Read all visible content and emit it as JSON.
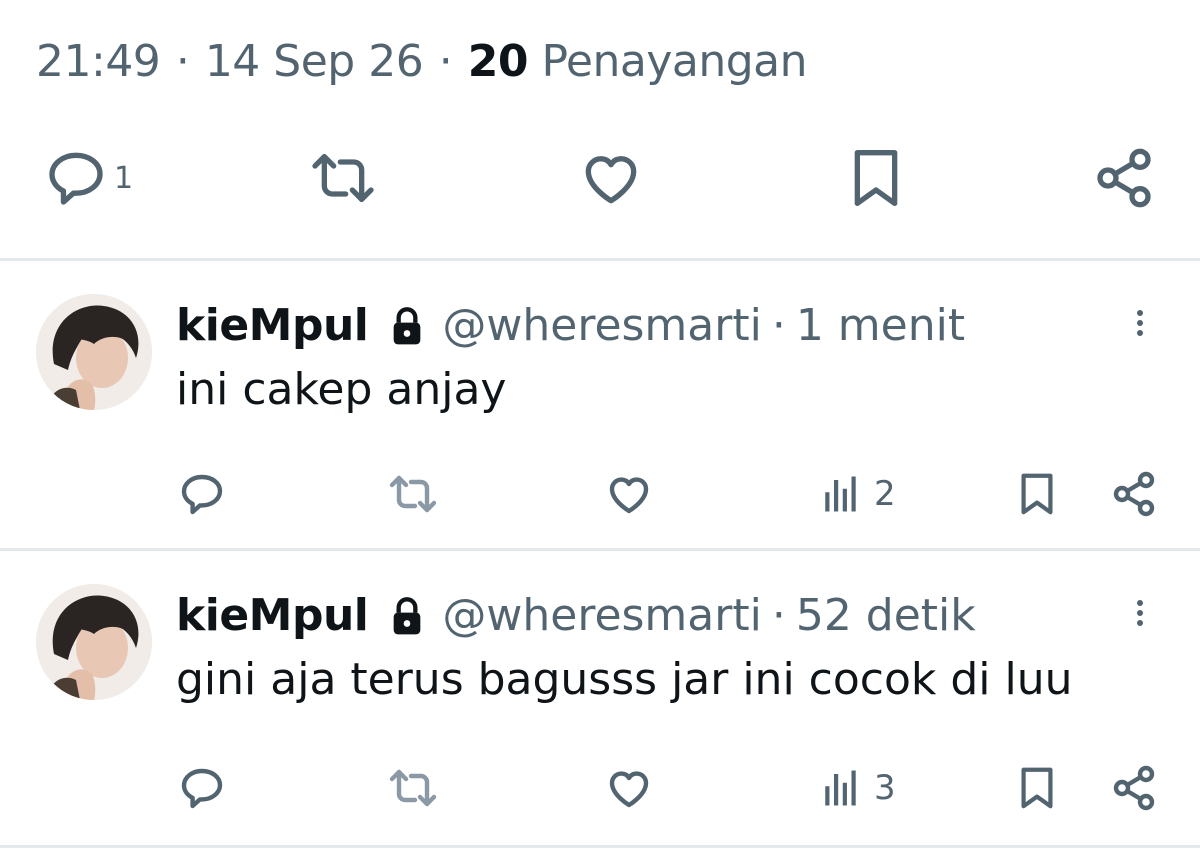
{
  "post_meta": {
    "time": "21:49",
    "separator": "·",
    "date": "14 Sep 26",
    "views_count": "20",
    "views_label": "Penayangan"
  },
  "main_actions": {
    "reply_count": "1"
  },
  "replies": [
    {
      "name": "kieMpul",
      "handle": "@wheresmarti",
      "separator": "·",
      "time": "1 menit",
      "text": "ini cakep anjay",
      "views": "2"
    },
    {
      "name": "kieMpul",
      "handle": "@wheresmarti",
      "separator": "·",
      "time": "52 detik",
      "text": "gini aja terus bagusss jar ini cocok di luu",
      "views": "3"
    }
  ],
  "colors": {
    "text_primary": "#0f1419",
    "text_secondary": "#536471",
    "icon_muted": "#8b98a5",
    "divider": "#e6e9eb"
  }
}
